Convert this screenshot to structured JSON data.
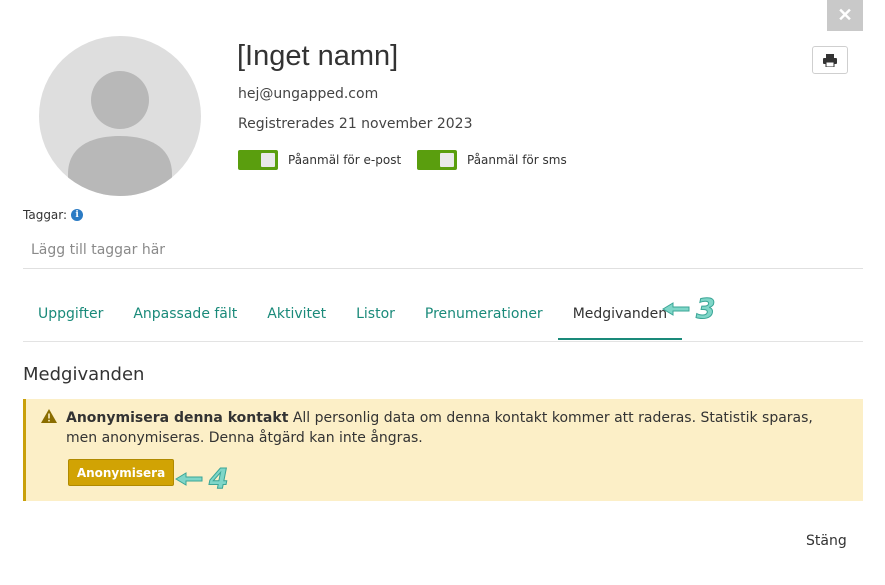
{
  "dialog": {
    "close_glyph": "✕",
    "close_label": "Stäng"
  },
  "contact": {
    "name": "[Inget namn]",
    "email": "hej@ungapped.com",
    "registered": "Registrerades 21 november 2023",
    "subscriptions": [
      {
        "label": "Påanmäl för e-post",
        "on": true
      },
      {
        "label": "Påanmäl för sms",
        "on": true
      }
    ]
  },
  "tags": {
    "label": "Taggar:",
    "placeholder": "Lägg till taggar här"
  },
  "tabs": [
    {
      "label": "Uppgifter",
      "active": false
    },
    {
      "label": "Anpassade fält",
      "active": false
    },
    {
      "label": "Aktivitet",
      "active": false
    },
    {
      "label": "Listor",
      "active": false
    },
    {
      "label": "Prenumerationer",
      "active": false
    },
    {
      "label": "Medgivanden",
      "active": true
    }
  ],
  "annotations": {
    "tab_marker": "3",
    "button_marker": "4"
  },
  "consent": {
    "title": "Medgivanden",
    "warning_title": "Anonymisera denna kontakt",
    "warning_body": "All personlig data om denna kontakt kommer att raderas. Statistik sparas, men anonymiseras. Denna åtgärd kan inte ångras.",
    "button_label": "Anonymisera"
  },
  "colors": {
    "accent": "#1a8a7a",
    "toggle_on": "#5a9e0e",
    "warning_bg": "#fcefc7",
    "warning_button": "#d1a304"
  },
  "icons": {
    "close": "close-icon",
    "print": "print-icon",
    "info": "info-icon",
    "warning": "warning-icon",
    "arrow": "arrow-left-icon"
  }
}
